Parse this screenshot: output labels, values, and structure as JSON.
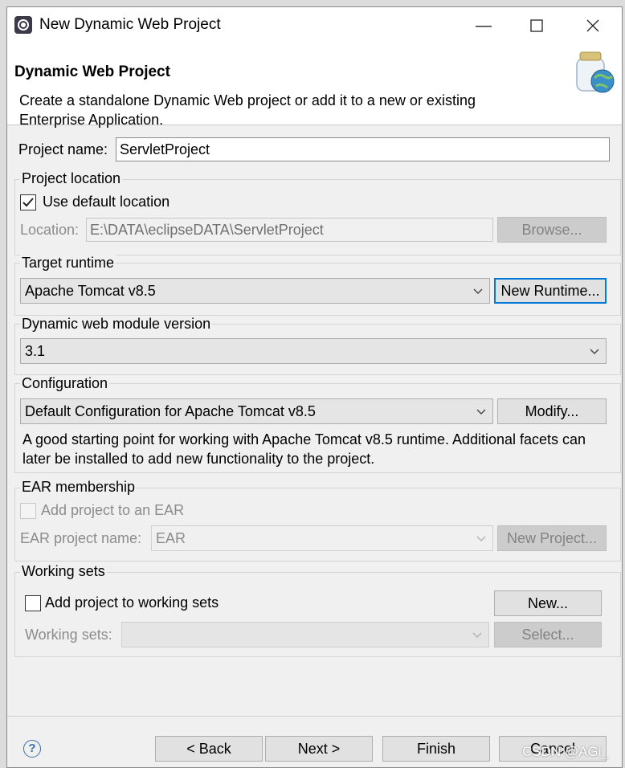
{
  "window": {
    "title": "New Dynamic Web Project"
  },
  "header": {
    "title": "Dynamic Web Project",
    "description": "Create a standalone Dynamic Web project or add it to a new or existing Enterprise Application."
  },
  "project_name": {
    "label": "Project name:",
    "value": "ServletProject"
  },
  "project_location": {
    "title": "Project location",
    "use_default_label": "Use default location",
    "use_default_checked": true,
    "location_label": "Location:",
    "location_value": "E:\\DATA\\eclipseDATA\\ServletProject",
    "browse_label": "Browse..."
  },
  "target_runtime": {
    "title": "Target runtime",
    "selected": "Apache Tomcat v8.5",
    "new_runtime_label": "New Runtime..."
  },
  "module_version": {
    "title": "Dynamic web module version",
    "selected": "3.1"
  },
  "configuration": {
    "title": "Configuration",
    "selected": "Default Configuration for Apache Tomcat v8.5",
    "modify_label": "Modify...",
    "description": "A good starting point for working with Apache Tomcat v8.5 runtime. Additional facets can later be installed to add new functionality to the project."
  },
  "ear_membership": {
    "title": "EAR membership",
    "add_label": "Add project to an EAR",
    "project_name_label": "EAR project name:",
    "project_name_value": "EAR",
    "new_project_label": "New Project..."
  },
  "working_sets": {
    "title": "Working sets",
    "add_label": "Add project to working sets",
    "new_label": "New...",
    "sets_label": "Working sets:",
    "select_label": "Select..."
  },
  "footer": {
    "back_label": "< Back",
    "next_label": "Next >",
    "finish_label": "Finish",
    "cancel_label": "Cancel"
  },
  "watermark": "CSDN @AGi_",
  "icons": [
    "eclipse-icon",
    "minimize-icon",
    "maximize-icon",
    "close-icon",
    "wizard-jar-globe-icon",
    "help-icon",
    "chevron-down-icon",
    "checkmark-icon"
  ]
}
